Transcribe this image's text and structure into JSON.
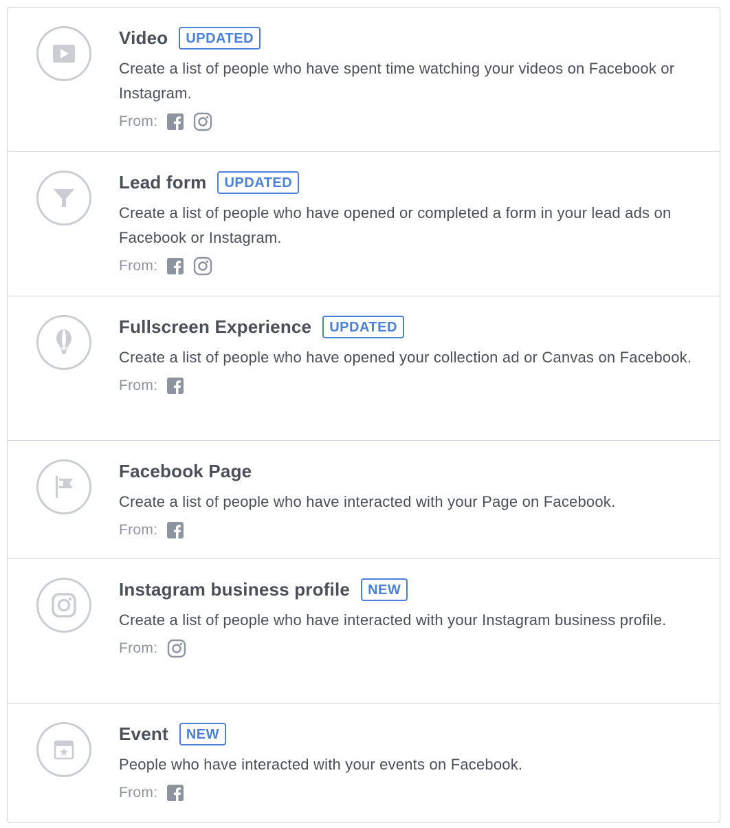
{
  "colors": {
    "badge": "#4a80d8",
    "title": "#4b4f56",
    "muted": "#90949c",
    "icon": "#cbcdd2",
    "source_icon": "#8d949e"
  },
  "from_label": "From:",
  "items": [
    {
      "icon": "video-play-icon",
      "title": "Video",
      "badge": "UPDATED",
      "description": "Create a list of people who have spent time watching your videos on Facebook or Instagram.",
      "sources": [
        "facebook-icon",
        "instagram-icon"
      ]
    },
    {
      "icon": "funnel-icon",
      "title": "Lead form",
      "badge": "UPDATED",
      "description": "Create a list of people who have opened or completed a form in your lead ads on Facebook or Instagram.",
      "sources": [
        "facebook-icon",
        "instagram-icon"
      ]
    },
    {
      "icon": "balloon-icon",
      "title": "Fullscreen Experience",
      "badge": "UPDATED",
      "description": "Create a list of people who have opened your collection ad or Canvas on Facebook.",
      "sources": [
        "facebook-icon"
      ]
    },
    {
      "icon": "flag-icon",
      "title": "Facebook Page",
      "badge": "",
      "description": "Create a list of people who have interacted with your Page on Facebook.",
      "sources": [
        "facebook-icon"
      ]
    },
    {
      "icon": "instagram-icon",
      "title": "Instagram business profile",
      "badge": "NEW",
      "description": "Create a list of people who have interacted with your Instagram business profile.",
      "sources": [
        "instagram-icon"
      ]
    },
    {
      "icon": "calendar-star-icon",
      "title": "Event",
      "badge": "NEW",
      "description": "People who have interacted with your events on Facebook.",
      "sources": [
        "facebook-icon"
      ]
    }
  ]
}
